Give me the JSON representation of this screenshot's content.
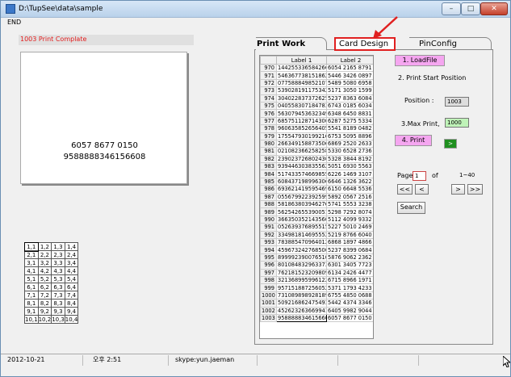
{
  "window": {
    "title": "D:\\TupSee\\data\\sample",
    "min": "–",
    "max": "□",
    "close": "✕"
  },
  "menu": {
    "end": "END"
  },
  "status_message": "1003 Print Complate",
  "preview": {
    "line1": "6057 8677 0150",
    "line2": "9588888346156608"
  },
  "layout_grid": [
    [
      "1,1",
      "1,2",
      "1,3",
      "1,4"
    ],
    [
      "2,1",
      "2,2",
      "2,3",
      "2,4"
    ],
    [
      "3,1",
      "3,2",
      "3,3",
      "3,4"
    ],
    [
      "4,1",
      "4,2",
      "4,3",
      "4,4"
    ],
    [
      "5,1",
      "5,2",
      "5,3",
      "5,4"
    ],
    [
      "6,1",
      "6,2",
      "6,3",
      "6,4"
    ],
    [
      "7,1",
      "7,2",
      "7,3",
      "7,4"
    ],
    [
      "8,1",
      "8,2",
      "8,3",
      "8,4"
    ],
    [
      "9,1",
      "9,2",
      "9,3",
      "9,4"
    ],
    [
      "10,1",
      "10,2",
      "10,3",
      "10,4"
    ]
  ],
  "tabs": {
    "print": "Print Work",
    "card": "Card Design",
    "pin": "PinConfig"
  },
  "table": {
    "headers": [
      "",
      "Label 1",
      "Label 2"
    ],
    "rows": [
      [
        "970",
        "1442553365842660",
        "6054 2165 8791"
      ],
      [
        "971",
        "5463677381518621",
        "5446 3426 0897"
      ],
      [
        "972",
        "0775888498521072",
        "5489 5080 6958"
      ],
      [
        "973",
        "5390281911753421",
        "5171 3050 1599"
      ],
      [
        "974",
        "3040228373726252",
        "5237 8363 6084"
      ],
      [
        "975",
        "0405583071847833",
        "6743 0185 6034"
      ],
      [
        "976",
        "5630794536323496",
        "6348 6450 8831"
      ],
      [
        "977",
        "6857511287143002",
        "6287 5275 5334"
      ],
      [
        "978",
        "9606358526564050",
        "5541 8189 0482"
      ],
      [
        "979",
        "1755479301992169",
        "6753 5095 8896"
      ],
      [
        "980",
        "2663491588735062",
        "6869 2520 2633"
      ],
      [
        "981",
        "0210823662582587",
        "5330 6528 2736"
      ],
      [
        "982",
        "2390237268024302",
        "5328 3844 8192"
      ],
      [
        "983",
        "9394463038355628",
        "5051 6930 5563"
      ],
      [
        "984",
        "5174335746698557",
        "6226 1469 3107"
      ],
      [
        "985",
        "6084371989963062",
        "6646 1326 3622"
      ],
      [
        "986",
        "6936214195954699",
        "6150 6648 5536"
      ],
      [
        "987",
        "0556799223925998",
        "5892 0567 2516"
      ],
      [
        "988",
        "5818638039462767",
        "5741 5553 3238"
      ],
      [
        "989",
        "5625426553900519",
        "5298 7292 8074"
      ],
      [
        "990",
        "3663503521435608",
        "5112 4099 9332"
      ],
      [
        "991",
        "0526393768955155",
        "5227 5010 2469"
      ],
      [
        "992",
        "3349818146955529",
        "5219 8766 6040"
      ],
      [
        "993",
        "7838854709640120",
        "6868 1897 4866"
      ],
      [
        "994",
        "4596732427685007",
        "5237 8399 0684"
      ],
      [
        "995",
        "8999923900765107",
        "5876 9062 2362"
      ],
      [
        "996",
        "8010848329633738",
        "6301 3405 7723"
      ],
      [
        "997",
        "7621815232098099",
        "6134 2426 4477"
      ],
      [
        "998",
        "3213689959961224",
        "6715 8966 1971"
      ],
      [
        "999",
        "9571518872560524",
        "5371 1793 4233"
      ],
      [
        "1000",
        "7310898989281895",
        "6755 4850 0688"
      ],
      [
        "1001",
        "5092168624754939",
        "5442 4374 3346"
      ],
      [
        "1002",
        "4526232636699413",
        "6405 9982 9044"
      ],
      [
        "1003",
        "9588888346156608",
        "6057 8677 0150"
      ]
    ],
    "selected_row": "1003"
  },
  "controls": {
    "load_file": "1. LoadFile",
    "start_position": "2. Print Start Position",
    "position_label": "Position :",
    "position_value": "1003",
    "max_print_label": "3.Max Print,",
    "max_print_value": "1000",
    "print": "4. Print",
    "go": ">",
    "page_label": "Page",
    "page_value": "1",
    "of_label": "of",
    "range": "1~40",
    "first": "<<",
    "prev": "<",
    "next": ">",
    "last": ">>",
    "search": "Search"
  },
  "statusbar": {
    "date": "2012-10-21",
    "time": "오후 2:51",
    "skype": "skype:yun.jaeman",
    "cell4": "",
    "cell5": ""
  },
  "colors": {
    "accent_pink": "#f5a6f0",
    "highlight_red": "#e02020",
    "max_field_green": "#bff3b8",
    "go_green": "#1f8f1f"
  }
}
